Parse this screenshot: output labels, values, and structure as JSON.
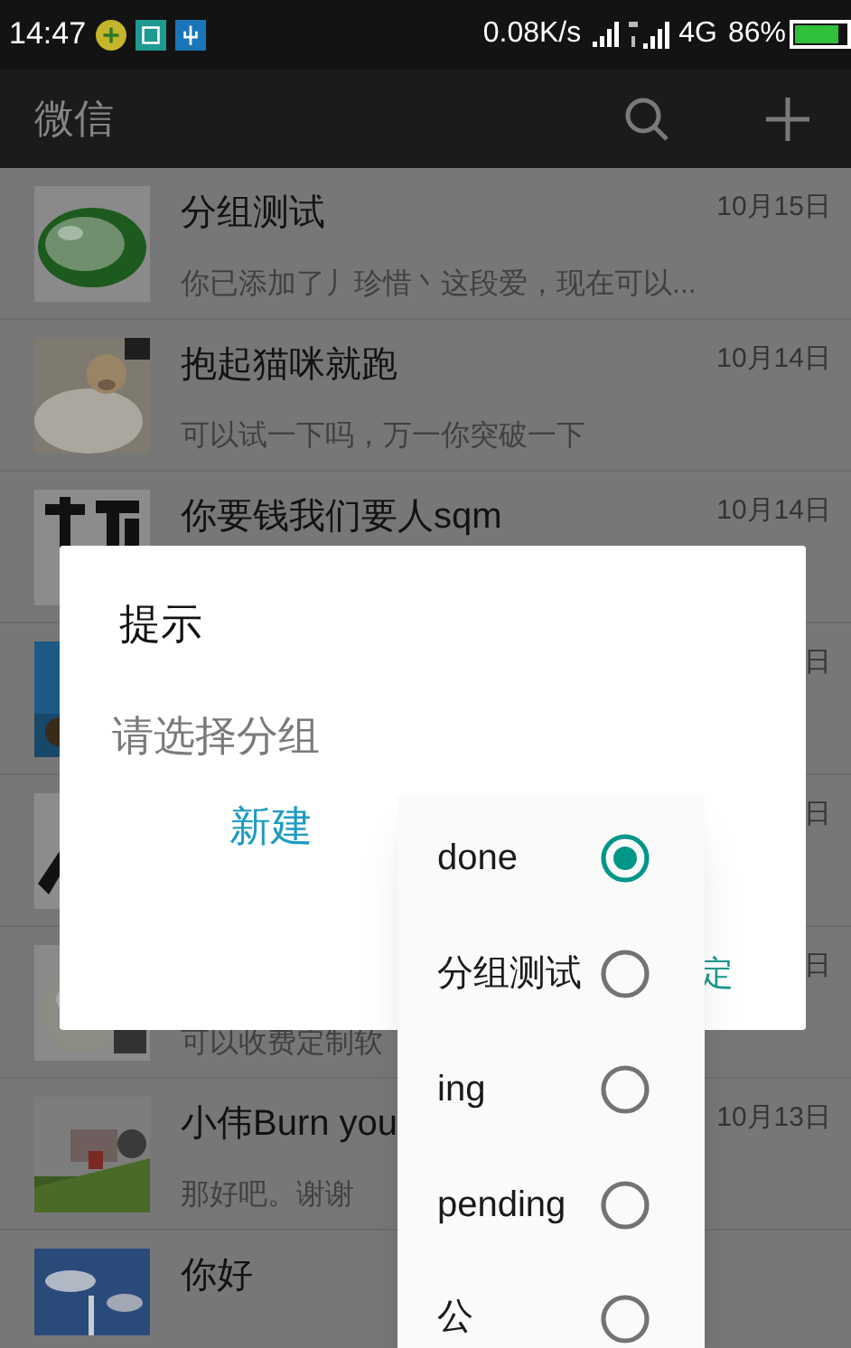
{
  "status_bar": {
    "time": "14:47",
    "net_speed": "0.08K/s",
    "network": "4G",
    "battery": "86%"
  },
  "app_bar": {
    "title": "微信"
  },
  "chats": [
    {
      "title": "分组测试",
      "preview": "你已添加了丿珍惜丶这段爱，现在可以...",
      "date": "10月15日"
    },
    {
      "title": "抱起猫咪就跑",
      "preview": "可以试一下吗，万一你突破一下",
      "date": "10月14日"
    },
    {
      "title": "你要钱我们要人sqm",
      "date": "10月14日"
    },
    {
      "date": "日"
    },
    {
      "date": "日"
    },
    {
      "preview": "可以收费定制软",
      "date": "日"
    },
    {
      "title": "小伟Burn you",
      "preview": "那好吧。谢谢",
      "date": "10月13日"
    },
    {
      "title": "你好"
    }
  ],
  "dialog": {
    "title": "提示",
    "message": "请选择分组",
    "new_button": "新建",
    "confirm_button": "定"
  },
  "menu": {
    "options": [
      {
        "label": "done",
        "selected": true
      },
      {
        "label": "分组测试",
        "selected": false
      },
      {
        "label": "ing",
        "selected": false
      },
      {
        "label": "pending",
        "selected": false
      },
      {
        "label": "公",
        "selected": false
      }
    ]
  }
}
